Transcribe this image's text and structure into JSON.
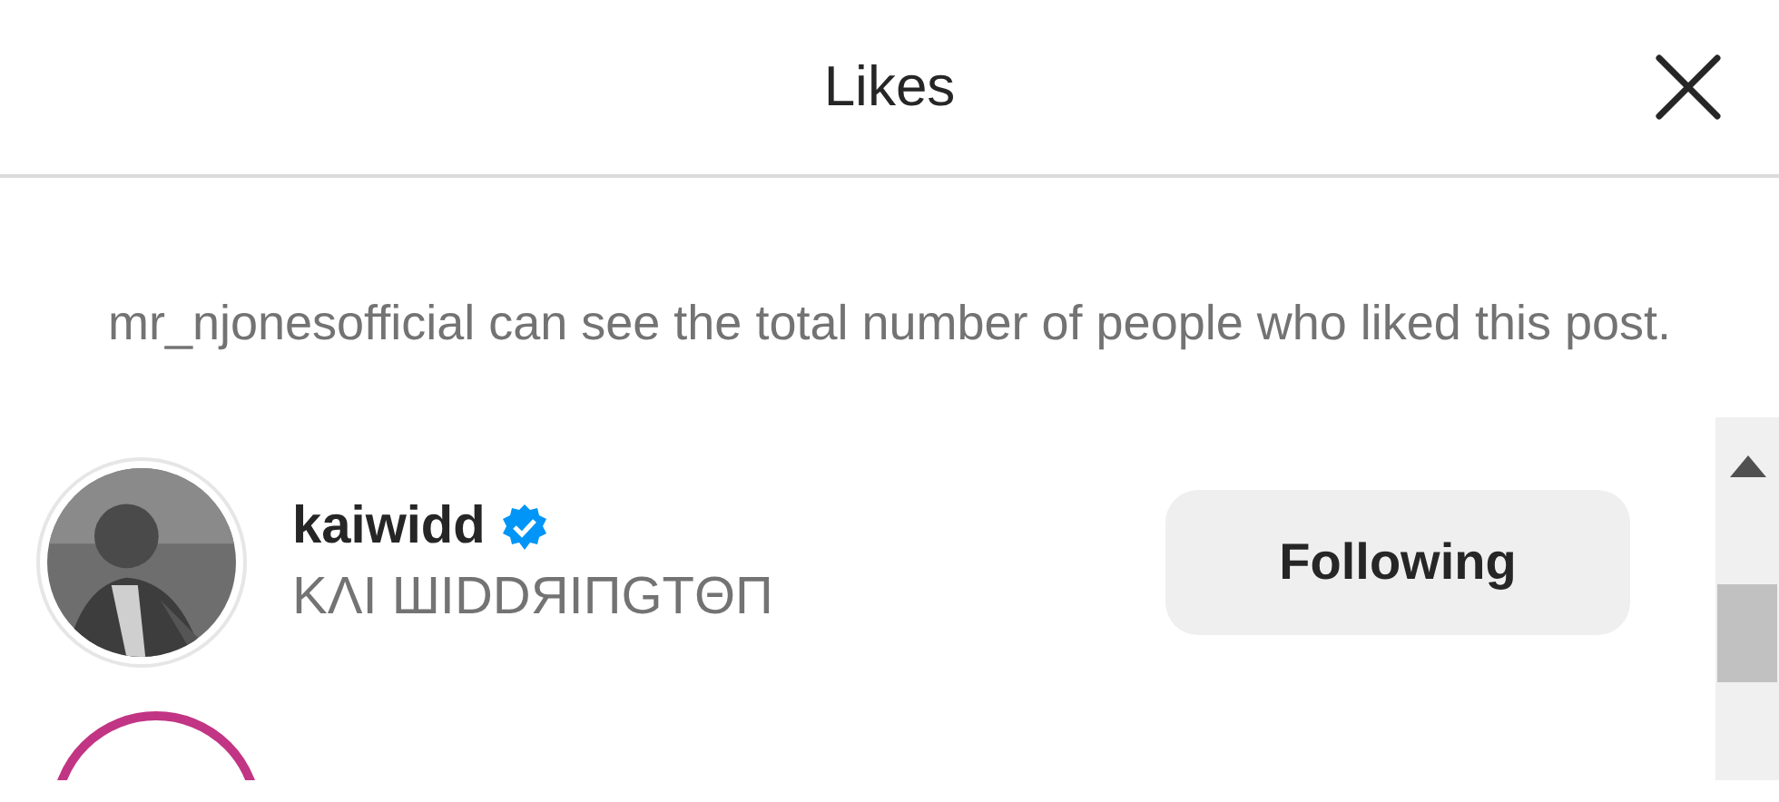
{
  "header": {
    "title": "Likes"
  },
  "notice": "mr_njonesofficial can see the total number of people who liked this post.",
  "users": [
    {
      "username": "kaiwidd",
      "verified": true,
      "display_name": "KΛI ШIDDЯIПGTΘП",
      "button": "Following",
      "has_story": false
    },
    {
      "has_story": true
    }
  ]
}
